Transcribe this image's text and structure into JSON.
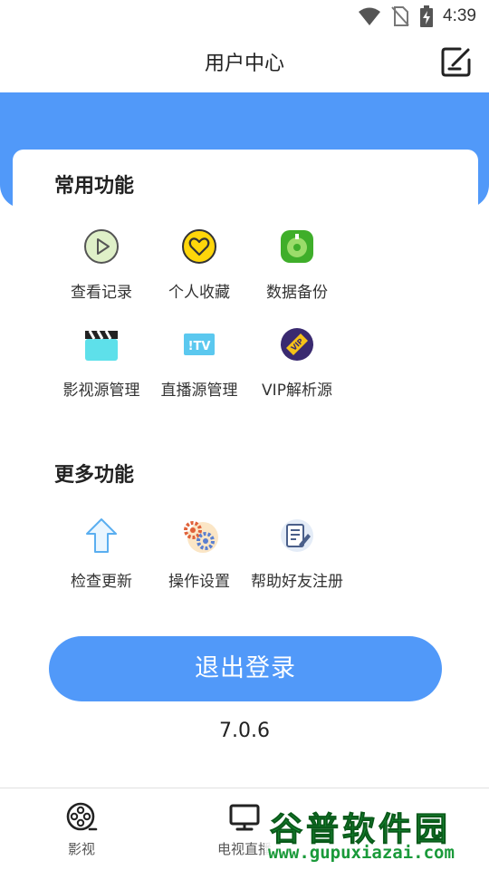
{
  "status_bar": {
    "time": "4:39"
  },
  "header": {
    "title": "用户中心"
  },
  "sections": {
    "common": {
      "title": "常用功能",
      "items": [
        "查看记录",
        "个人收藏",
        "数据备份",
        "影视源管理",
        "直播源管理",
        "VIP解析源"
      ]
    },
    "more": {
      "title": "更多功能",
      "items": [
        "检查更新",
        "操作设置",
        "帮助好友注册"
      ]
    }
  },
  "logout_label": "退出登录",
  "version": "7.0.6",
  "bottom_nav": {
    "items": [
      "影视",
      "电视直播"
    ]
  },
  "watermark": {
    "line1": "谷普软件园",
    "line2": "www.gupuxiazai.com"
  },
  "colors": {
    "accent": "#5199f9",
    "text": "#222222",
    "watermark": "#1a9a3a"
  }
}
